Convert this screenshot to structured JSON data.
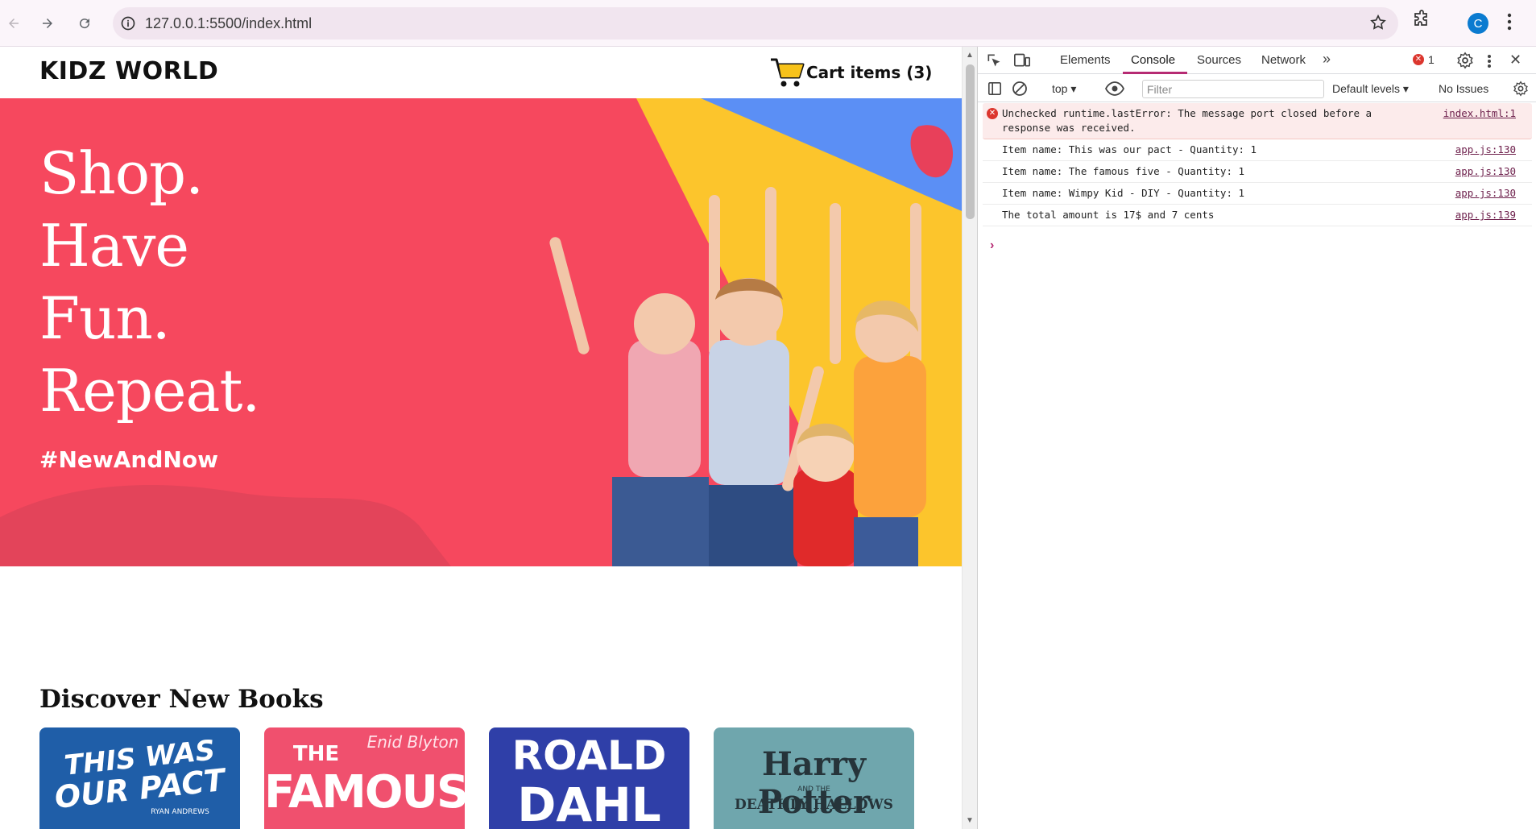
{
  "browser": {
    "url": "127.0.0.1:5500/index.html",
    "profile_initial": "C"
  },
  "site": {
    "logo": "KIDZ WORLD",
    "cart_label": "Cart items (3)",
    "hero_lines": [
      "Shop.",
      "Have",
      "Fun.",
      "Repeat."
    ],
    "hashtag": "#NewAndNow",
    "section_title": "Discover New Books",
    "books": [
      {
        "line1": "THIS WAS",
        "line2": "OUR PACT",
        "author": "RYAN ANDREWS",
        "bg": "#1f5ea8"
      },
      {
        "line1": "THE",
        "line2": "FAMOUS",
        "author": "Enid Blyton",
        "bg": "#f0506e"
      },
      {
        "line1": "ROALD",
        "line2": "DAHL",
        "author": "",
        "bg": "#2f3fa8"
      },
      {
        "line1": "Harry Potter",
        "line2": "DEATHLY HALLOWS",
        "author": "AND THE",
        "bg": "#6fa6ad"
      }
    ]
  },
  "devtools": {
    "tabs": [
      "Elements",
      "Console",
      "Sources",
      "Network"
    ],
    "active_tab": "Console",
    "error_count": "1",
    "context": "top",
    "filter_placeholder": "Filter",
    "levels": "Default levels",
    "issues": "No Issues",
    "logs": [
      {
        "type": "error",
        "message": "Unchecked runtime.lastError: The message port closed before a response was received.",
        "source": "index.html:1"
      },
      {
        "type": "log",
        "message": "Item name: This was our pact - Quantity: 1",
        "source": "app.js:130"
      },
      {
        "type": "log",
        "message": "Item name: The famous five - Quantity: 1",
        "source": "app.js:130"
      },
      {
        "type": "log",
        "message": "Item name: Wimpy Kid - DIY - Quantity: 1",
        "source": "app.js:130"
      },
      {
        "type": "log",
        "message": "The total amount is 17$ and 7 cents",
        "source": "app.js:139"
      }
    ]
  },
  "colors": {
    "hero_bg": "#f6485e",
    "accent_yellow": "#fcc52c",
    "accent_blue": "#5b8ff5",
    "devtools_accent": "#b62b73"
  }
}
